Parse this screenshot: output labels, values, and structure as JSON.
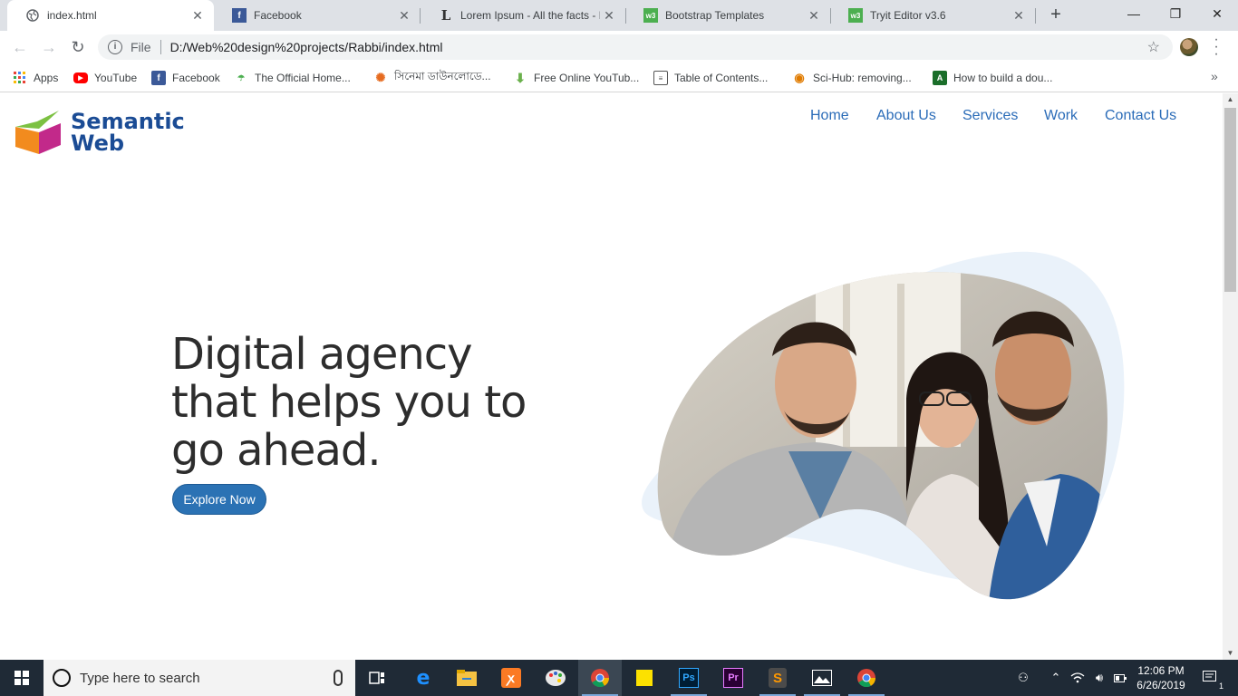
{
  "browser": {
    "tabs": [
      {
        "title": "index.html",
        "icon": "globe-icon",
        "active": true
      },
      {
        "title": "Facebook",
        "icon": "facebook-icon",
        "active": false
      },
      {
        "title": "Lorem Ipsum - All the facts - Li",
        "icon": "lipsum-icon",
        "active": false
      },
      {
        "title": "Bootstrap Templates",
        "icon": "w3-icon",
        "active": false
      },
      {
        "title": "Tryit Editor v3.6",
        "icon": "w3-icon",
        "active": false
      }
    ],
    "scheme_label": "File",
    "url": "D:/Web%20design%20projects/Rabbi/index.html",
    "bookmarks": [
      {
        "label": "Apps",
        "icon": "apps-grid-icon"
      },
      {
        "label": "YouTube",
        "icon": "youtube-icon"
      },
      {
        "label": "Facebook",
        "icon": "facebook-icon"
      },
      {
        "label": "The Official Home...",
        "icon": "site-icon"
      },
      {
        "label": "সিনেমা ডাউনলোডে...",
        "icon": "fire-icon"
      },
      {
        "label": "Free Online YouTub...",
        "icon": "download-arrow-icon"
      },
      {
        "label": "Table of Contents...",
        "icon": "document-icon"
      },
      {
        "label": "Sci-Hub: removing...",
        "icon": "eye-icon"
      },
      {
        "label": "How to build a dou...",
        "icon": "android-icon"
      }
    ]
  },
  "page": {
    "logo_line1": "Semantic",
    "logo_line2": "Web",
    "nav": [
      "Home",
      "About Us",
      "Services",
      "Work",
      "Contact Us"
    ],
    "hero_title": "Digital agency that helps you to go ahead.",
    "hero_button": "Explore Now",
    "colors": {
      "brand": "#1b4c95",
      "nav": "#2b6cb8",
      "button": "#2b72b4",
      "blob": "#eaf2fa"
    }
  },
  "taskbar": {
    "search_placeholder": "Type here to search",
    "time": "12:06 PM",
    "date": "6/26/2019",
    "notification_count": "1"
  }
}
